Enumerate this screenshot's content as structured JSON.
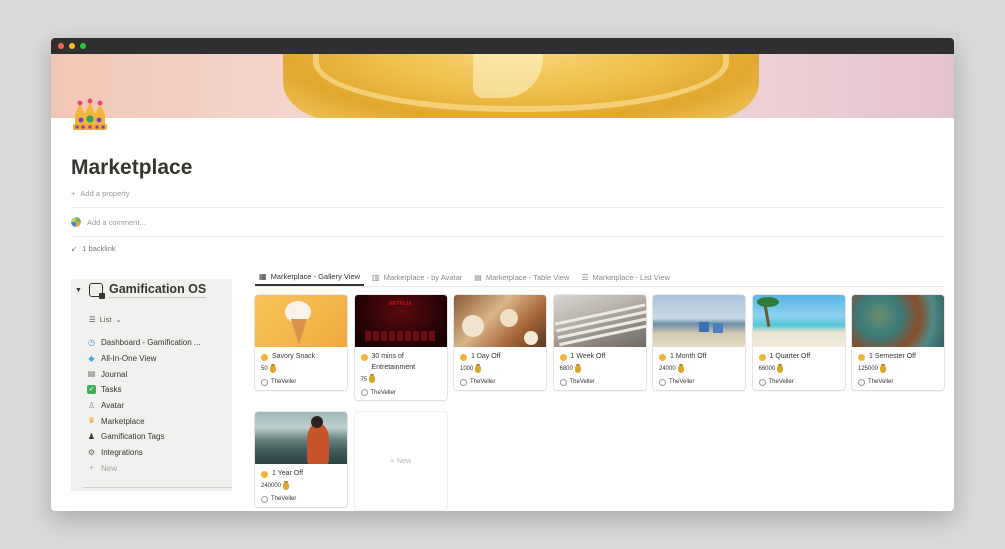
{
  "page": {
    "title": "Marketplace",
    "add_property": "Add a property",
    "add_comment": "Add a comment...",
    "backlink": "1 backlink"
  },
  "sidebar": {
    "title": "Gamification OS",
    "view_label": "List",
    "items": [
      {
        "label": "Dashboard - Gamification ...",
        "icon": "dashboard-icon"
      },
      {
        "label": "All-In-One View",
        "icon": "gem-icon"
      },
      {
        "label": "Journal",
        "icon": "notebook-icon"
      },
      {
        "label": "Tasks",
        "icon": "checkbox-icon"
      },
      {
        "label": "Avatar",
        "icon": "avatar-icon"
      },
      {
        "label": "Marketplace",
        "icon": "crown-icon"
      },
      {
        "label": "Gamification Tags",
        "icon": "tag-icon"
      },
      {
        "label": "Integrations",
        "icon": "gear-icon"
      }
    ],
    "new_label": "New"
  },
  "tabs": [
    {
      "label": "Marketplace - Gallery View",
      "icon": "gallery-icon",
      "active": true
    },
    {
      "label": "Marketplace - by Avatar",
      "icon": "board-icon",
      "active": false
    },
    {
      "label": "Marketplace - Table View",
      "icon": "table-icon",
      "active": false
    },
    {
      "label": "Marketplace - List View",
      "icon": "list-icon",
      "active": false
    }
  ],
  "cards": [
    {
      "title": "Savory Snack",
      "price": "50",
      "owner": "TheVeller",
      "image": "ice-cream"
    },
    {
      "title": "30 mins of Entretainment",
      "price": "75",
      "owner": "TheVeller",
      "image": "netflix"
    },
    {
      "title": "1 Day Off",
      "price": "1000",
      "owner": "TheVeller",
      "image": "food-table"
    },
    {
      "title": "1 Week Off",
      "price": "6800",
      "owner": "TheVeller",
      "image": "hammock"
    },
    {
      "title": "1 Month Off",
      "price": "24000",
      "owner": "TheVeller",
      "image": "beach-chairs"
    },
    {
      "title": "1 Quarter Off",
      "price": "66000",
      "owner": "TheVeller",
      "image": "tropical-beach"
    },
    {
      "title": "1 Semester Off",
      "price": "125000",
      "owner": "TheVeller",
      "image": "world-map"
    },
    {
      "title": "1 Year Off",
      "price": "240000",
      "owner": "TheVeller",
      "image": "mountain-lake"
    }
  ],
  "netflix_logo": "NETFLIX",
  "new_card_label": "New",
  "colors": {
    "text": "#37352f",
    "muted": "#9b9a97",
    "sidebar_bg": "#f1f1ef",
    "coin": "#f1b33a"
  }
}
